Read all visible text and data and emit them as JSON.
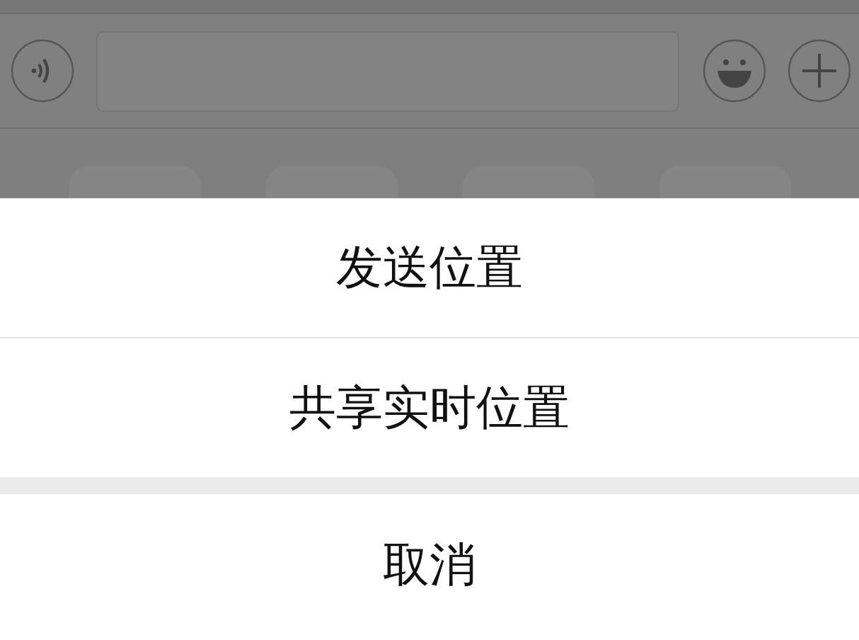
{
  "action_sheet": {
    "actions": [
      {
        "label": "发送位置"
      },
      {
        "label": "共享实时位置"
      }
    ],
    "cancel": {
      "label": "取消"
    }
  }
}
